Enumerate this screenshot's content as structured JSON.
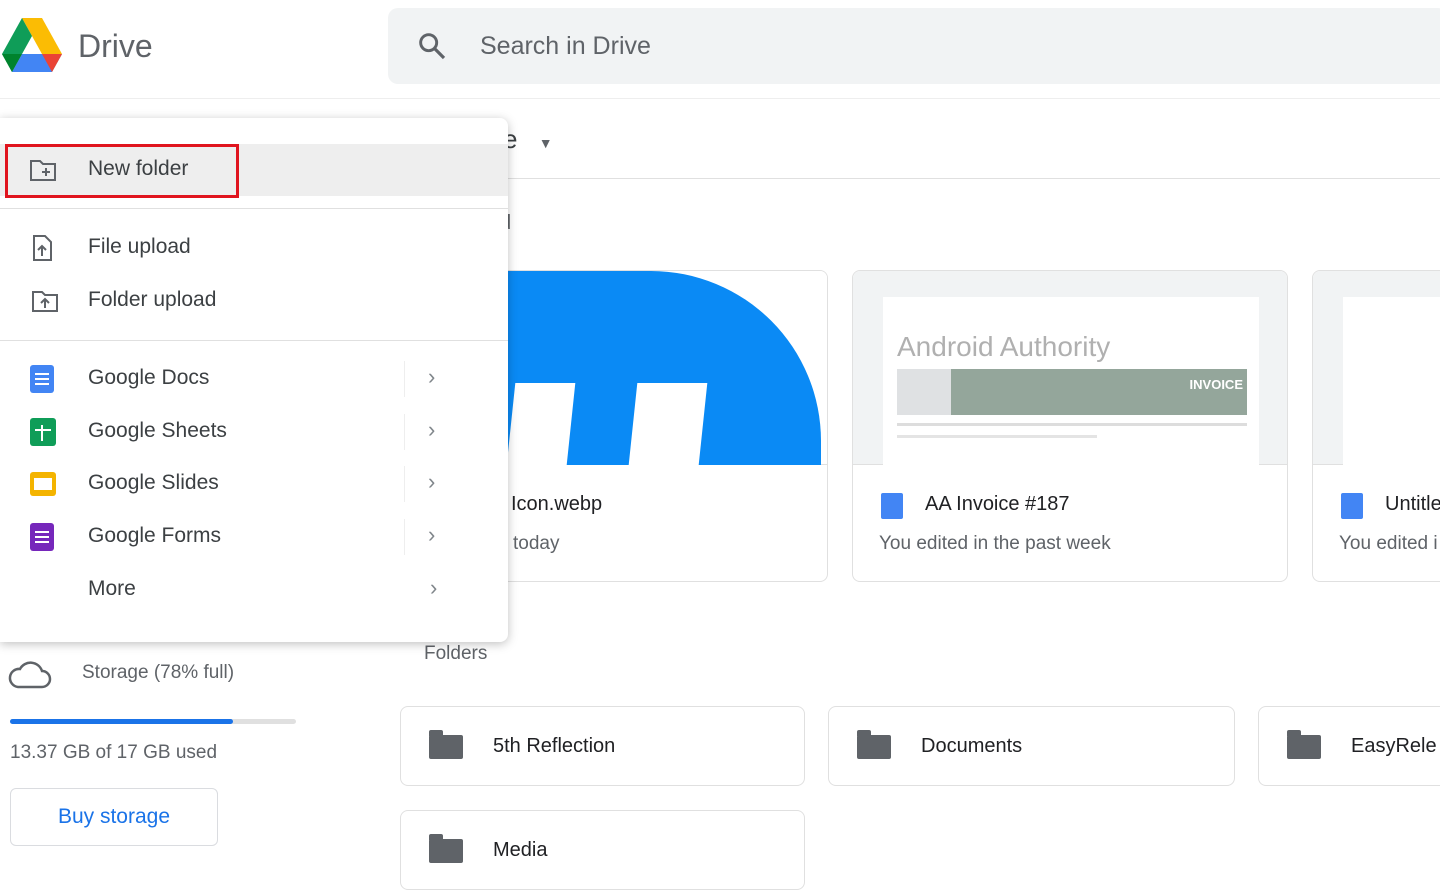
{
  "header": {
    "app_name": "Drive",
    "search_placeholder": "Search in Drive"
  },
  "main": {
    "location_title_partial": "ve",
    "section_suggested_partial": "d",
    "suggested": [
      {
        "title": "Icon.webp",
        "subtitle": "today",
        "thumb_color": "#0a8af5"
      },
      {
        "title": "AA Invoice #187",
        "subtitle": "You edited in the past week",
        "thumb_heading": "Android Authority",
        "thumb_banner": "INVOICE",
        "icon": "docs-icon"
      },
      {
        "title": "Untitle",
        "subtitle": "You edited i",
        "icon": "docs-icon"
      }
    ],
    "folders_label": "Folders",
    "folders": [
      {
        "name": "5th Reflection",
        "icon": "folder-icon"
      },
      {
        "name": "Documents",
        "icon": "folder-icon"
      },
      {
        "name": "EasyRele",
        "icon": "shared-folder-icon"
      },
      {
        "name": "Media",
        "icon": "folder-icon"
      }
    ]
  },
  "new_menu": {
    "items": [
      {
        "label": "New folder",
        "icon": "new-folder-icon",
        "highlighted": true
      },
      {
        "label": "File upload",
        "icon": "file-upload-icon"
      },
      {
        "label": "Folder upload",
        "icon": "folder-upload-icon"
      },
      {
        "label": "Google Docs",
        "icon": "docs-icon",
        "color": "#4285f4"
      },
      {
        "label": "Google Sheets",
        "icon": "sheets-icon",
        "color": "#0f9d58"
      },
      {
        "label": "Google Slides",
        "icon": "slides-icon",
        "color": "#f4b400"
      },
      {
        "label": "Google Forms",
        "icon": "forms-icon",
        "color": "#7627bb"
      },
      {
        "label": "More"
      }
    ],
    "highlight_box_color": "#e0141e"
  },
  "storage": {
    "label": "Storage (78% full)",
    "percent_used": 78,
    "used_text": "13.37 GB of 17 GB used",
    "buy_label": "Buy storage"
  }
}
